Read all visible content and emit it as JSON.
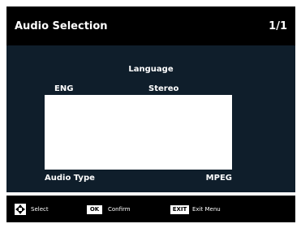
{
  "header": {
    "title": "Audio Selection",
    "page": "1/1"
  },
  "language_panel": {
    "heading": "Language",
    "items": [
      {
        "code": "ENG",
        "mode": "Stereo",
        "selected": true
      }
    ]
  },
  "audio_type": {
    "label": "Audio Type",
    "value": "MPEG"
  },
  "footer": {
    "select": {
      "icon": "dpad-icon",
      "label": "Select"
    },
    "confirm": {
      "key": "OK",
      "label": "Confirm"
    },
    "exit": {
      "key": "EXIT",
      "label": "Exit Menu"
    }
  },
  "colors": {
    "title_bg": "#000000",
    "panel_bg": "#0f1e2b",
    "list_bg": "#ffffff",
    "text": "#ffffff"
  }
}
